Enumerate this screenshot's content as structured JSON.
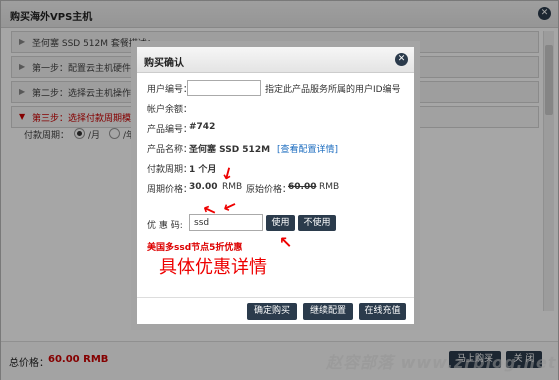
{
  "window": {
    "title": "购买海外VPS主机",
    "close_glyph": "✕"
  },
  "steps": [
    {
      "label": "圣何塞 SSD 512M 套餐描述：",
      "arrow": "▶"
    },
    {
      "label": "第一步：配置云主机硬件性能",
      "arrow": "▶"
    },
    {
      "label": "第二步：选择云主机操作系统",
      "arrow": "▶"
    },
    {
      "label": "第三步：选择付款周期模式",
      "arrow": "▼"
    }
  ],
  "pay_period": {
    "label": "付款周期：",
    "options": [
      {
        "label": "/月",
        "checked": true
      },
      {
        "label": "/年(",
        "checked": false
      }
    ]
  },
  "footer": {
    "total_label": "总价格：",
    "total_value": "60.00 RMB",
    "buy_label": "马上购买",
    "close_label": "关 闭"
  },
  "dialog": {
    "title": "购买确认",
    "close_glyph": "✕",
    "user_id_label": "用户编号：",
    "user_id_value": "",
    "user_id_hint": "指定此产品服务所属的用户ID编号",
    "balance_label": "帐户余额：",
    "product_id_label": "产品编号：",
    "product_id_value": "#742",
    "product_name_label": "产品名称：",
    "product_name_value": "圣何塞 SSD 512M",
    "product_detail_link": "[查看配置详情]",
    "period_label": "付款周期：",
    "period_value": "1 个月",
    "price_label": "周期价格：",
    "price_value": "30.00",
    "price_unit": "RMB",
    "original_label": "原始价格：",
    "original_value": "60.00",
    "original_unit": "RMB",
    "coupon_label": "优 惠 码:",
    "coupon_value": "ssd",
    "use_label": "使用",
    "no_use_label": "不使用",
    "buttons": {
      "confirm": "确定购买",
      "continue": "继续配置",
      "recharge": "在线充值"
    }
  },
  "annotations": {
    "note": "美国多ssd节点5折优惠",
    "detail": "具体优惠详情"
  },
  "watermark": "赵容部落 www.zrblog.net"
}
